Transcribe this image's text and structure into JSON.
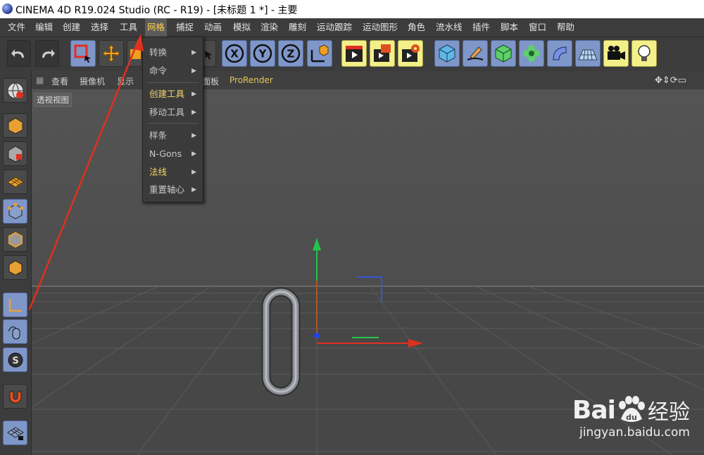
{
  "window": {
    "title": "CINEMA 4D R19.024 Studio (RC - R19) - [未标题 1 *] - 主要"
  },
  "menubar": {
    "items": [
      "文件",
      "编辑",
      "创建",
      "选择",
      "工具",
      "网格",
      "捕捉",
      "动画",
      "模拟",
      "渲染",
      "雕刻",
      "运动跟踪",
      "运动图形",
      "角色",
      "流水线",
      "插件",
      "脚本",
      "窗口",
      "帮助"
    ],
    "active_index": 5,
    "active_color": "#ffd24a"
  },
  "mesh_menu": {
    "items": [
      {
        "label": "转换",
        "submenu": true
      },
      {
        "label": "命令",
        "submenu": true
      },
      {
        "label": "创建工具",
        "submenu": true
      },
      {
        "label": "移动工具",
        "submenu": true
      },
      {
        "label": "样条",
        "submenu": true
      },
      {
        "label": "N-Gons",
        "submenu": true
      },
      {
        "label": "法线",
        "submenu": true
      },
      {
        "label": "重置轴心",
        "submenu": true
      }
    ],
    "arrow": "▶"
  },
  "toolbar": {
    "undo": "undo-icon",
    "redo": "redo-icon",
    "x_label": "X",
    "y_label": "Y",
    "z_label": "Z"
  },
  "viewport_header": {
    "items": [
      "查看",
      "摄像机",
      "显示",
      "面板",
      "ProRender"
    ],
    "view_label": "透视视图"
  },
  "watermark": {
    "brand": "Bai",
    "brand2": "经验",
    "url": "jingyan.baidu.com"
  },
  "colors": {
    "accent_yellow": "#ffd24a",
    "annotation_red": "#e0301e",
    "axis_x": "#e03020",
    "axis_y": "#22c44a",
    "axis_z": "#3355dd"
  }
}
